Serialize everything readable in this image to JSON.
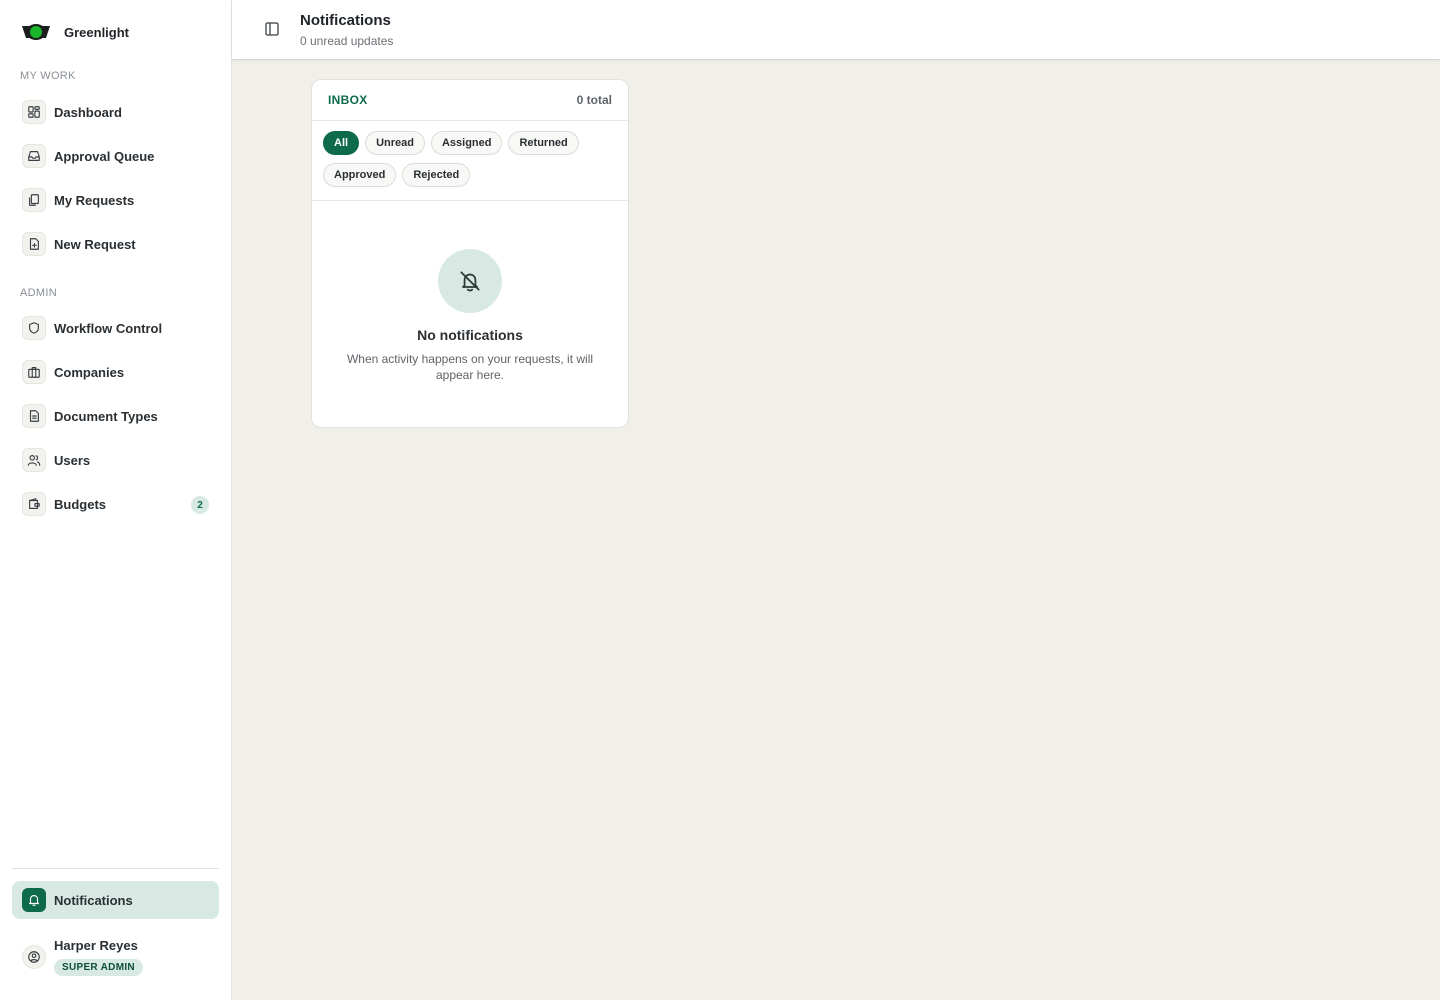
{
  "brand": {
    "name": "Greenlight",
    "logo": "traffic-light-logo"
  },
  "sidebar": {
    "sections": [
      {
        "label": "MY WORK"
      },
      {
        "label": "ADMIN"
      }
    ],
    "items": [
      {
        "label": "Dashboard",
        "icon": "dashboard-icon"
      },
      {
        "label": "Approval Queue",
        "icon": "inbox-icon"
      },
      {
        "label": "My Requests",
        "icon": "copy-icon"
      },
      {
        "label": "New Request",
        "icon": "file-plus-icon"
      },
      {
        "label": "Workflow Control",
        "icon": "shield-icon"
      },
      {
        "label": "Companies",
        "icon": "briefcase-icon"
      },
      {
        "label": "Document Types",
        "icon": "document-icon"
      },
      {
        "label": "Users",
        "icon": "users-icon"
      },
      {
        "label": "Budgets",
        "icon": "wallet-icon",
        "badge": "2"
      }
    ],
    "notifications": {
      "label": "Notifications",
      "icon": "bell-icon"
    },
    "user": {
      "name": "Harper Reyes",
      "role": "SUPER ADMIN"
    }
  },
  "header": {
    "title": "Notifications",
    "subtitle": "0 unread updates"
  },
  "inbox": {
    "title": "INBOX",
    "total": "0 total",
    "filters": [
      "All",
      "Unread",
      "Assigned",
      "Returned",
      "Approved",
      "Rejected"
    ],
    "active_filter": "All",
    "empty_title": "No notifications",
    "empty_text": "When activity happens on your requests, it will appear here."
  },
  "colors": {
    "accent": "#0d6b4b",
    "accent_soft": "#d7e9e2",
    "background": "#f0efea"
  }
}
